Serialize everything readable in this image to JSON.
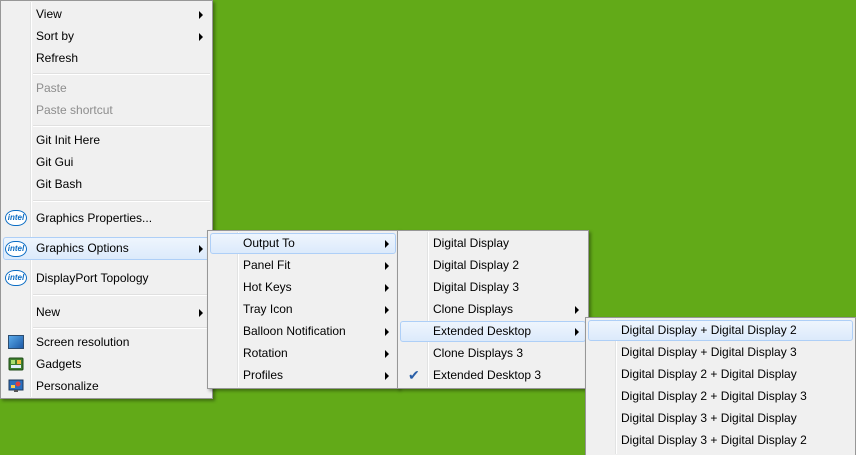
{
  "desktop_menu": {
    "items": [
      {
        "label": "View",
        "submenu": true
      },
      {
        "label": "Sort by",
        "submenu": true
      },
      {
        "label": "Refresh"
      },
      {
        "label": "Paste",
        "disabled": true
      },
      {
        "label": "Paste shortcut",
        "disabled": true
      },
      {
        "label": "Git Init Here"
      },
      {
        "label": "Git Gui"
      },
      {
        "label": "Git Bash"
      },
      {
        "label": "Graphics Properties...",
        "icon": "intel-logo-icon"
      },
      {
        "label": "Graphics Options",
        "icon": "intel-logo-icon",
        "submenu": true,
        "highlighted": true
      },
      {
        "label": "DisplayPort Topology",
        "icon": "intel-logo-icon"
      },
      {
        "label": "New",
        "submenu": true
      },
      {
        "label": "Screen resolution",
        "icon": "screen-resolution-icon"
      },
      {
        "label": "Gadgets",
        "icon": "gadgets-icon"
      },
      {
        "label": "Personalize",
        "icon": "personalize-icon"
      }
    ],
    "intel_icon_text": "intel"
  },
  "graphics_options_menu": {
    "items": [
      {
        "label": "Output To",
        "submenu": true,
        "highlighted": true
      },
      {
        "label": "Panel Fit",
        "submenu": true
      },
      {
        "label": "Hot Keys",
        "submenu": true
      },
      {
        "label": "Tray Icon",
        "submenu": true
      },
      {
        "label": "Balloon Notification",
        "submenu": true
      },
      {
        "label": "Rotation",
        "submenu": true
      },
      {
        "label": "Profiles",
        "submenu": true
      }
    ]
  },
  "output_to_menu": {
    "items": [
      {
        "label": "Digital Display"
      },
      {
        "label": "Digital Display 2"
      },
      {
        "label": "Digital Display 3"
      },
      {
        "label": "Clone Displays",
        "submenu": true
      },
      {
        "label": "Extended Desktop",
        "submenu": true,
        "highlighted": true
      },
      {
        "label": "Clone Displays 3"
      },
      {
        "label": "Extended Desktop 3",
        "checked": true
      }
    ],
    "check_glyph": "✔"
  },
  "extended_desktop_menu": {
    "items": [
      {
        "label": "Digital Display + Digital Display 2",
        "highlighted": true
      },
      {
        "label": "Digital Display + Digital Display 3"
      },
      {
        "label": "Digital Display 2 + Digital Display"
      },
      {
        "label": "Digital Display 2 + Digital Display 3"
      },
      {
        "label": "Digital Display 3 + Digital Display"
      },
      {
        "label": "Digital Display 3 + Digital Display 2"
      }
    ]
  }
}
